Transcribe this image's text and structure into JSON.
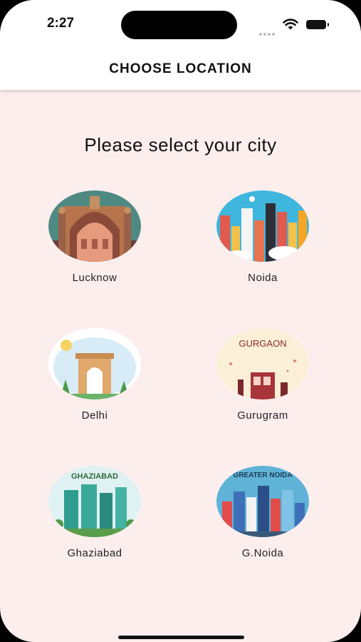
{
  "status_bar": {
    "time": "2:27"
  },
  "header": {
    "title": "CHOOSE LOCATION"
  },
  "prompt": "Please select your city",
  "cities": [
    {
      "name": "Lucknow"
    },
    {
      "name": "Noida"
    },
    {
      "name": "Delhi"
    },
    {
      "name": "Gurugram",
      "image_text": "GURGAON"
    },
    {
      "name": "Ghaziabad",
      "image_text": "GHAZIABAD"
    },
    {
      "name": "G.Noida",
      "image_text": "GREATER NOIDA"
    }
  ],
  "colors": {
    "background": "#fdeeee",
    "header": "#ffffff",
    "text": "#111111"
  }
}
